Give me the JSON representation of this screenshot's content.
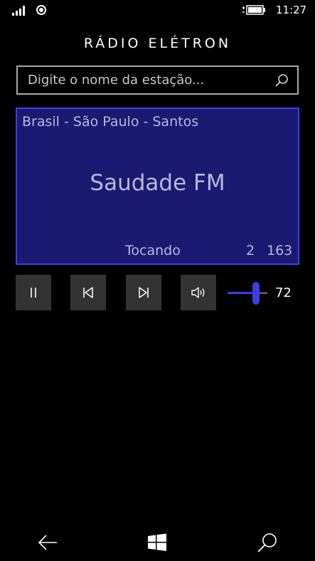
{
  "status_bar": {
    "time": "11:27",
    "signal_icon": "signal-bars-icon",
    "wifi_icon": "wifi-icon",
    "battery_icon": "battery-charging-icon"
  },
  "app": {
    "title": "RÁDIO ELÉTRON"
  },
  "search": {
    "placeholder": "Digite o nome da estação...",
    "value": "",
    "icon": "search-icon"
  },
  "station": {
    "location": "Brasil - São Paulo - Santos",
    "name": "Saudade FM",
    "status": "Tocando",
    "index": "2",
    "count": "163",
    "colors": {
      "background": "#1a1a73",
      "border": "#3e3ee6",
      "text": "#b8b8d8"
    }
  },
  "controls": {
    "pause_icon": "pause-icon",
    "previous_icon": "skip-previous-icon",
    "next_icon": "skip-next-icon",
    "volume_icon": "speaker-icon",
    "volume": 72
  },
  "nav": {
    "back_icon": "back-arrow-icon",
    "start_icon": "windows-logo-icon",
    "search_icon": "search-icon"
  },
  "colors": {
    "accent": "#3e3ee6",
    "button_bg": "#333333"
  }
}
